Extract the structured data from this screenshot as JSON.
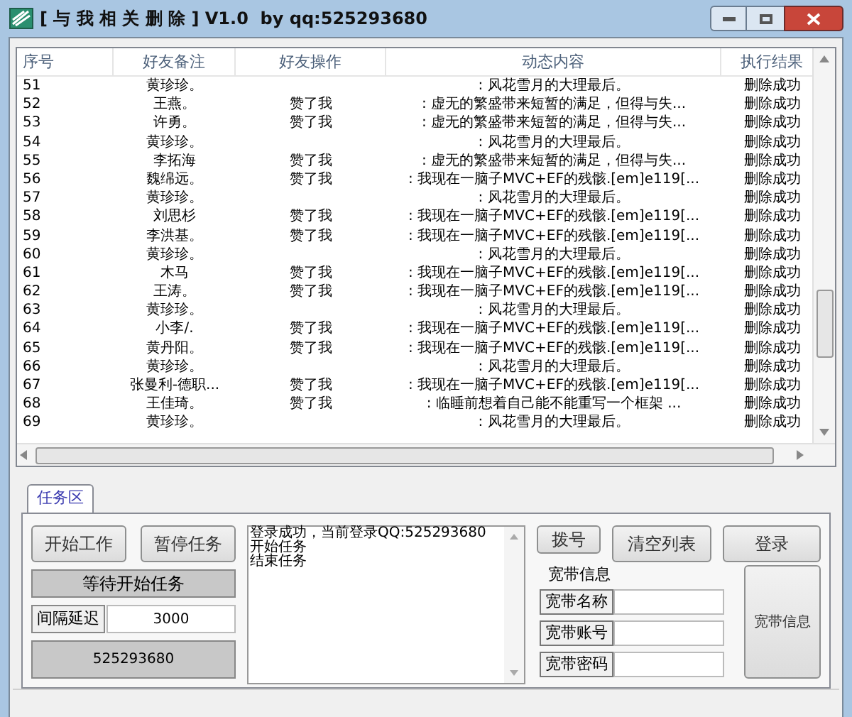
{
  "window": {
    "title": "[ 与 我 相 关 删 除 ] V1.0  by qq:525293680"
  },
  "table": {
    "columns": [
      "序号",
      "好友备注",
      "好友操作",
      "动态内容",
      "执行结果"
    ],
    "rows": [
      {
        "cells": [
          "51",
          "黄珍珍。",
          "",
          ": 风花雪月的大理最后。",
          "删除成功"
        ]
      },
      {
        "cells": [
          "52",
          "王燕。",
          "赞了我",
          ": 虚无的繁盛带来短暂的满足，但得与失...",
          "删除成功"
        ]
      },
      {
        "cells": [
          "53",
          "许勇。",
          "赞了我",
          ": 虚无的繁盛带来短暂的满足，但得与失...",
          "删除成功"
        ]
      },
      {
        "cells": [
          "54",
          "黄珍珍。",
          "",
          ": 风花雪月的大理最后。",
          "删除成功"
        ]
      },
      {
        "cells": [
          "55",
          "李拓海",
          "赞了我",
          ": 虚无的繁盛带来短暂的满足，但得与失...",
          "删除成功"
        ]
      },
      {
        "cells": [
          "56",
          "魏绵远。",
          "赞了我",
          ": 我现在一脑子MVC+EF的残骸.[em]e119[...",
          "删除成功"
        ]
      },
      {
        "cells": [
          "57",
          "黄珍珍。",
          "",
          ": 风花雪月的大理最后。",
          "删除成功"
        ]
      },
      {
        "cells": [
          "58",
          "刘思杉",
          "赞了我",
          ": 我现在一脑子MVC+EF的残骸.[em]e119[...",
          "删除成功"
        ]
      },
      {
        "cells": [
          "59",
          "李洪基。",
          "赞了我",
          ": 我现在一脑子MVC+EF的残骸.[em]e119[...",
          "删除成功"
        ]
      },
      {
        "cells": [
          "60",
          "黄珍珍。",
          "",
          ": 风花雪月的大理最后。",
          "删除成功"
        ]
      },
      {
        "cells": [
          "61",
          "木马",
          "赞了我",
          ": 我现在一脑子MVC+EF的残骸.[em]e119[...",
          "删除成功"
        ]
      },
      {
        "cells": [
          "62",
          "王涛。",
          "赞了我",
          ": 我现在一脑子MVC+EF的残骸.[em]e119[...",
          "删除成功"
        ]
      },
      {
        "cells": [
          "63",
          "黄珍珍。",
          "",
          ": 风花雪月的大理最后。",
          "删除成功"
        ]
      },
      {
        "cells": [
          "64",
          "小李/.",
          "赞了我",
          ": 我现在一脑子MVC+EF的残骸.[em]e119[...",
          "删除成功"
        ]
      },
      {
        "cells": [
          "65",
          "黄丹阳。",
          "赞了我",
          ": 我现在一脑子MVC+EF的残骸.[em]e119[...",
          "删除成功"
        ]
      },
      {
        "cells": [
          "66",
          "黄珍珍。",
          "",
          ": 风花雪月的大理最后。",
          "删除成功"
        ]
      },
      {
        "cells": [
          "67",
          "张曼利-德职...",
          "赞了我",
          ": 我现在一脑子MVC+EF的残骸.[em]e119[...",
          "删除成功"
        ]
      },
      {
        "cells": [
          "68",
          "王佳琦。",
          "赞了我",
          ": 临睡前想着自己能不能重写一个框架 ...",
          "删除成功"
        ]
      },
      {
        "cells": [
          "69",
          "黄珍珍。",
          "",
          ": 风花雪月的大理最后。",
          "删除成功"
        ]
      }
    ]
  },
  "tabs": [
    {
      "label": "任务区",
      "selected": true
    }
  ],
  "task_buttons": [
    "开始工作",
    "暂停任务"
  ],
  "status": "等待开始任务",
  "delay": {
    "label": "间隔延迟",
    "value": "3000"
  },
  "account": "525293680",
  "log": [
    "登录成功，当前登录QQ:525293680",
    "开始任务",
    "结束任务"
  ],
  "action_buttons": [
    "拨号",
    "清空列表",
    "登录"
  ],
  "broadband": {
    "title": "宽带信息",
    "fields": [
      {
        "label": "宽带名称"
      },
      {
        "label": "宽带账号"
      },
      {
        "label": "宽带密码"
      }
    ],
    "button": "宽带信息"
  }
}
